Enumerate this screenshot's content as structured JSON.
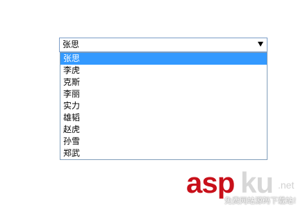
{
  "select": {
    "value": "张思",
    "options": [
      "张思",
      "李虎",
      "克斯",
      "李丽",
      "实力",
      "雄韬",
      "赵虎",
      "孙雪",
      "郑武"
    ],
    "selected_index": 0,
    "highlight_color": "#3399ff",
    "border_color": "#7a9cc7"
  },
  "watermark": {
    "brand_main": "asp",
    "brand_sub": "ku",
    "brand_tld": ".net",
    "slogan": "免费网站源码下载站!",
    "brand_color": "#c8101a"
  }
}
